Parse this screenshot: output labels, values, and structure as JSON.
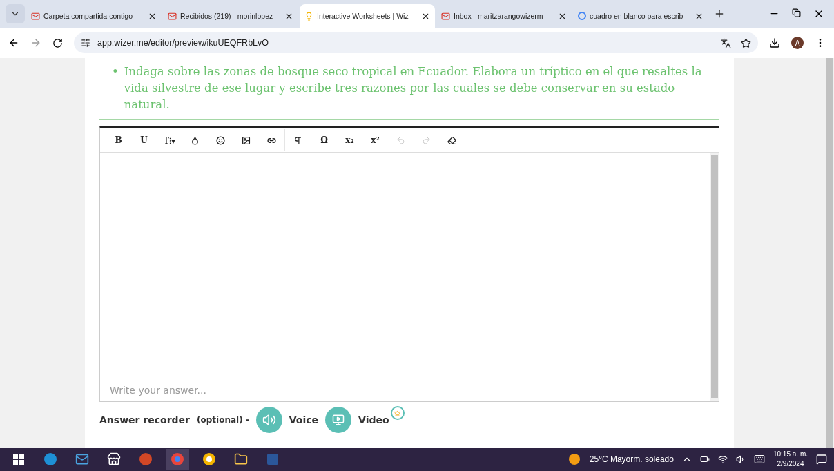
{
  "browser": {
    "tabs": [
      {
        "title": "Carpeta compartida contigo",
        "selected": false
      },
      {
        "title": "Recibidos (219) - morinlopez",
        "selected": false
      },
      {
        "title": "Interactive Worksheets | Wiz",
        "selected": true
      },
      {
        "title": "Inbox - maritzarangowizerm",
        "selected": false
      },
      {
        "title": "cuadro en blanco para escrib",
        "selected": false
      }
    ],
    "url": "app.wizer.me/editor/preview/ikuUEQFRbLvO",
    "profile": "A"
  },
  "task": {
    "bullet": "•",
    "text": "Indaga sobre las zonas de bosque seco tropical en Ecuador. Elabora un tríptico en el que resaltes la vida silvestre de ese lugar y escribe tres razones por las cuales se debe conservar en su estado natural."
  },
  "editor": {
    "toolbar": [
      {
        "kind": "text",
        "label": "B"
      },
      {
        "kind": "text",
        "label": "U"
      },
      {
        "kind": "text",
        "label": "T⁝▾"
      },
      {
        "kind": "icon"
      },
      {
        "kind": "icon"
      },
      {
        "kind": "icon"
      },
      {
        "kind": "icon"
      },
      {
        "kind": "divider"
      },
      {
        "kind": "icon"
      },
      {
        "kind": "divider"
      },
      {
        "kind": "text",
        "label": "Ω"
      },
      {
        "kind": "text",
        "label": "x₂"
      },
      {
        "kind": "text",
        "label": "x²"
      },
      {
        "kind": "icon",
        "disabled": true
      },
      {
        "kind": "icon",
        "disabled": true
      },
      {
        "kind": "icon",
        "disabled": false
      }
    ],
    "placeholder": "Write your answer..."
  },
  "recorder": {
    "label": "Answer recorder",
    "optional": "(optional) -",
    "voice": "Voice",
    "video": "Video"
  },
  "taskbar": {
    "weather": "25°C  Mayorm. soleado",
    "time": "10:15 a. m.",
    "date": "2/9/2024"
  }
}
